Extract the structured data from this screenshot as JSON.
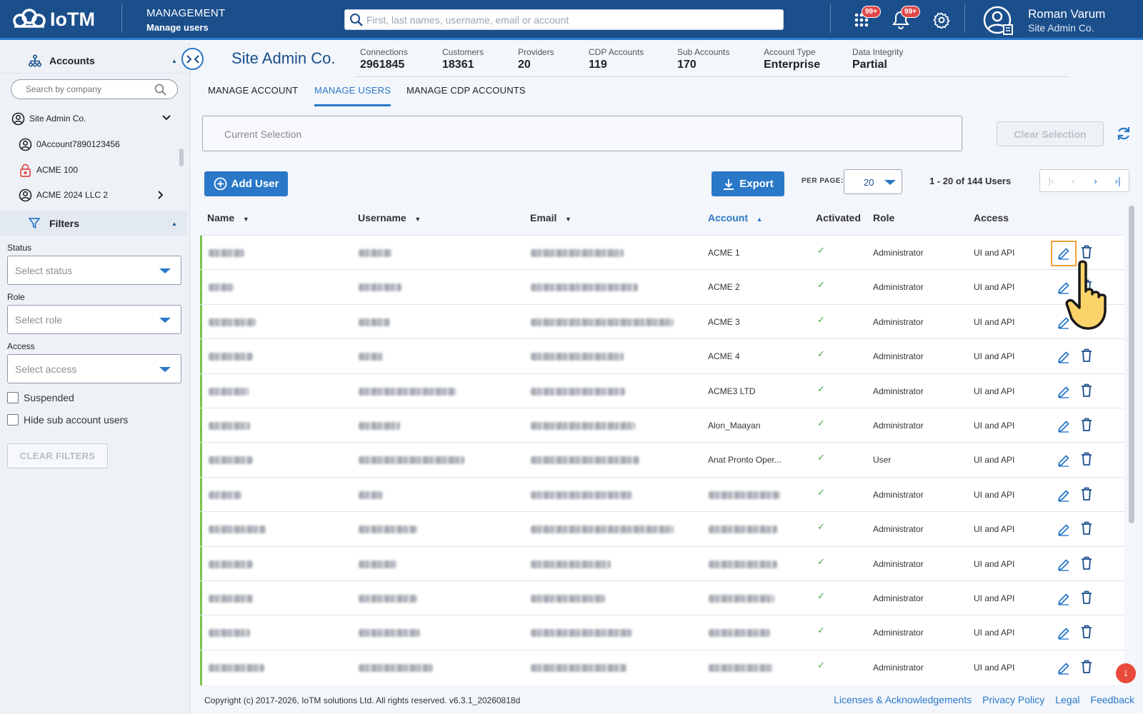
{
  "brand": {
    "logo_text": "IoTM"
  },
  "header": {
    "section": "MANAGEMENT",
    "page": "Manage users",
    "search_placeholder": "First, last names, username, email or account",
    "apps_badge": "99+",
    "notif_badge": "99+",
    "user_name": "Roman Varum",
    "user_account": "Site Admin Co."
  },
  "sidebar": {
    "accounts_label": "Accounts",
    "company_search_placeholder": "Search by company",
    "tree": [
      {
        "label": "Site Admin Co.",
        "icon": "account-circle-icon"
      },
      {
        "label": "0Account7890123456",
        "icon": "account-circle-icon"
      },
      {
        "label": "ACME 100",
        "icon": "lock-icon"
      },
      {
        "label": "ACME 2024 LLC 2",
        "icon": "account-circle-icon"
      }
    ],
    "filters_label": "Filters",
    "status_label": "Status",
    "status_placeholder": "Select status",
    "role_label": "Role",
    "role_placeholder": "Select role",
    "access_label": "Access",
    "access_placeholder": "Select access",
    "suspended_label": "Suspended",
    "hide_sub_label": "Hide sub account users",
    "clear_filters": "CLEAR FILTERS"
  },
  "account": {
    "title": "Site Admin Co.",
    "stats": [
      {
        "label": "Connections",
        "value": "2961845"
      },
      {
        "label": "Customers",
        "value": "18361"
      },
      {
        "label": "Providers",
        "value": "20"
      },
      {
        "label": "CDP Accounts",
        "value": "119"
      },
      {
        "label": "Sub Accounts",
        "value": "170"
      },
      {
        "label": "Account Type",
        "value": "Enterprise"
      },
      {
        "label": "Data Integrity",
        "value": "Partial"
      }
    ]
  },
  "tabs": [
    "MANAGE ACCOUNT",
    "MANAGE USERS",
    "MANAGE CDP ACCOUNTS"
  ],
  "active_tab": "MANAGE USERS",
  "selection": {
    "placeholder": "Current Selection",
    "clear_label": "Clear Selection"
  },
  "toolbar": {
    "add_user": "Add User",
    "export": "Export",
    "per_page_label": "PER PAGE:",
    "per_page_value": "20",
    "page_info": "1 - 20 of 144 Users"
  },
  "table": {
    "columns": [
      "Name",
      "Username",
      "Email",
      "Account",
      "Activated",
      "Role",
      "Access"
    ],
    "sorted_column": "Account",
    "rows": [
      {
        "account": "ACME 1",
        "role": "Administrator",
        "access": "UI and API"
      },
      {
        "account": "ACME 2",
        "role": "Administrator",
        "access": "UI and API"
      },
      {
        "account": "ACME 3",
        "role": "Administrator",
        "access": "UI and API"
      },
      {
        "account": "ACME 4",
        "role": "Administrator",
        "access": "UI and API"
      },
      {
        "account": "ACME3 LTD",
        "role": "Administrator",
        "access": "UI and API"
      },
      {
        "account": "Alon_Maayan",
        "role": "Administrator",
        "access": "UI and API"
      },
      {
        "account": "Anat Pronto Oper...",
        "role": "User",
        "access": "UI and API"
      },
      {
        "account": "",
        "role": "Administrator",
        "access": "UI and API"
      },
      {
        "account": "",
        "role": "Administrator",
        "access": "UI and API"
      },
      {
        "account": "",
        "role": "Administrator",
        "access": "UI and API"
      },
      {
        "account": "",
        "role": "Administrator",
        "access": "UI and API"
      },
      {
        "account": "",
        "role": "Administrator",
        "access": "UI and API"
      },
      {
        "account": "",
        "role": "Administrator",
        "access": "UI and API"
      }
    ]
  },
  "footer": {
    "copyright": "Copyright (c) 2017-2026, IoTM solutions Ltd. All rights reserved. v6.3.1_20260818d",
    "links": [
      "Licenses & Acknowledgements",
      "Privacy Policy",
      "Legal",
      "Feedback"
    ]
  },
  "colors": {
    "header": "#1b4f8c",
    "accent": "#2a78c8",
    "active_row_bar": "#7cc24b",
    "badge": "#e04848"
  }
}
